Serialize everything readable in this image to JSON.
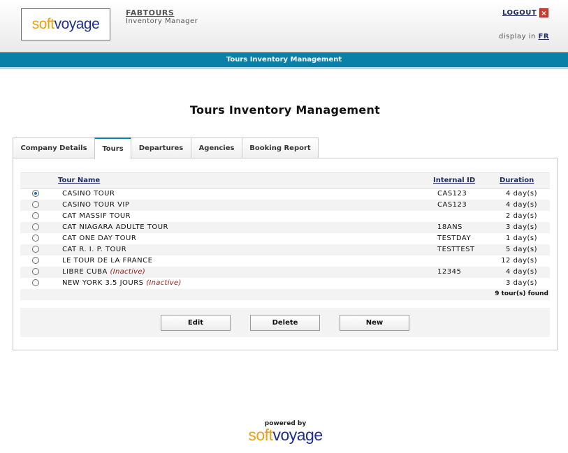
{
  "header": {
    "logo": {
      "part1": "soft",
      "part2": "voyage"
    },
    "company_name": "FABTOURS",
    "role": "Inventory Manager",
    "logout_label": "LOGOUT",
    "logout_icon": "close-icon",
    "display_in_label": "display in",
    "language_link": "FR"
  },
  "bluebar": {
    "title": "Tours Inventory Management"
  },
  "page": {
    "title": "Tours Inventory Management"
  },
  "tabs": [
    {
      "label": "Company Details",
      "active": false
    },
    {
      "label": "Tours",
      "active": true
    },
    {
      "label": "Departures",
      "active": false
    },
    {
      "label": "Agencies",
      "active": false
    },
    {
      "label": "Booking Report",
      "active": false
    }
  ],
  "table": {
    "columns": {
      "name": "Tour Name",
      "id": "Internal ID",
      "duration": "Duration"
    },
    "rows": [
      {
        "name": "CASINO TOUR",
        "status": "",
        "internal_id": "CAS123",
        "duration": "4 day(s)",
        "selected": true
      },
      {
        "name": "CASINO TOUR VIP",
        "status": "",
        "internal_id": "CAS123",
        "duration": "4 day(s)",
        "selected": false
      },
      {
        "name": "CAT MASSIF TOUR",
        "status": "",
        "internal_id": "",
        "duration": "2 day(s)",
        "selected": false
      },
      {
        "name": "CAT NIAGARA ADULTE TOUR",
        "status": "",
        "internal_id": "18ANS",
        "duration": "3 day(s)",
        "selected": false
      },
      {
        "name": "CAT ONE DAY TOUR",
        "status": "",
        "internal_id": "TESTDAY",
        "duration": "1 day(s)",
        "selected": false
      },
      {
        "name": "CAT R. I. P. TOUR",
        "status": "",
        "internal_id": "TESTTEST",
        "duration": "5 day(s)",
        "selected": false
      },
      {
        "name": "LE TOUR DE LA FRANCE",
        "status": "",
        "internal_id": "",
        "duration": "12 day(s)",
        "selected": false
      },
      {
        "name": "LIBRE CUBA",
        "status": "(Inactive)",
        "internal_id": "12345",
        "duration": "4 day(s)",
        "selected": false
      },
      {
        "name": "NEW YORK 3.5 JOURS",
        "status": "(Inactive)",
        "internal_id": "",
        "duration": "3 day(s)",
        "selected": false
      }
    ],
    "found_text": "9 tour(s) found"
  },
  "actions": {
    "edit": "Edit",
    "delete": "Delete",
    "new": "New"
  },
  "footer": {
    "powered_by": "powered by",
    "logo_part1": "soft",
    "logo_part2": "voyage"
  },
  "colors": {
    "accent": "#0a7fa8",
    "logo_orange": "#e8a317",
    "logo_blue": "#1e2f8c",
    "inactive": "#a01818"
  }
}
